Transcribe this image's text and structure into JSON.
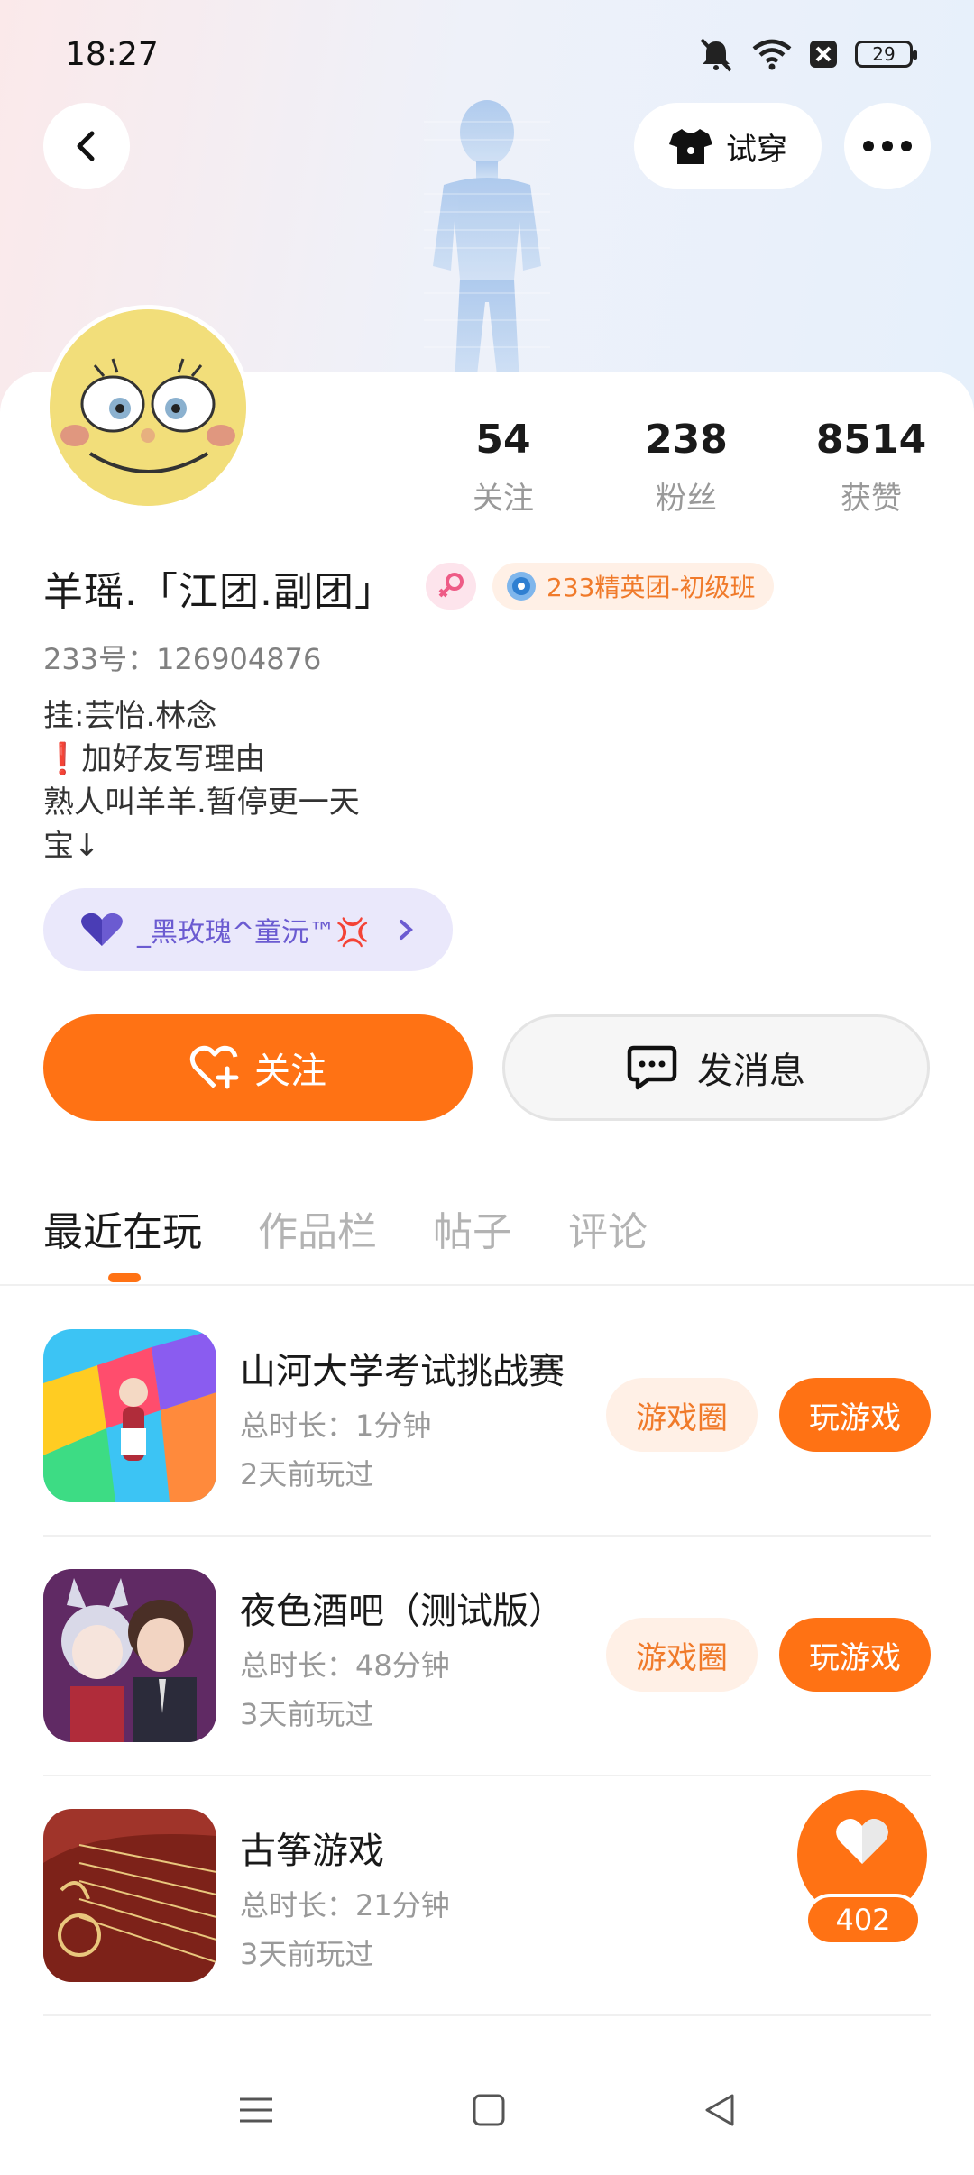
{
  "status_bar": {
    "time": "18:27",
    "battery": "29"
  },
  "header": {
    "tryon_label": "试穿"
  },
  "stats": [
    {
      "value": "54",
      "label": "关注"
    },
    {
      "value": "238",
      "label": "粉丝"
    },
    {
      "value": "8514",
      "label": "获赞"
    }
  ],
  "profile": {
    "name": "羊瑶.「江团.副团」",
    "group_badge": "233精英团-初级班",
    "uid": "233号：126904876",
    "bio": [
      "挂:芸怡.林念",
      "❗加好友写理由",
      "熟人叫羊羊.暂停更一天",
      "宝↓"
    ],
    "family": "_黑玫瑰^童沅™💢"
  },
  "actions": {
    "follow": "关注",
    "message": "发消息"
  },
  "tabs": [
    "最近在玩",
    "作品栏",
    "帖子",
    "评论"
  ],
  "games": [
    {
      "title": "山河大学考试挑战赛",
      "duration": "总时长：1分钟",
      "last_played": "2天前玩过",
      "circle_btn": "游戏圈",
      "play_btn": "玩游戏"
    },
    {
      "title": "夜色酒吧（测试版）",
      "duration": "总时长：48分钟",
      "last_played": "3天前玩过",
      "circle_btn": "游戏圈",
      "play_btn": "玩游戏"
    },
    {
      "title": "古筝游戏",
      "duration": "总时长：21分钟",
      "last_played": "3天前玩过"
    }
  ],
  "likes": "402",
  "colors": {
    "accent": "#ff7214",
    "accent_soft": "#fff0e6",
    "family_bg": "#eae8fb"
  }
}
